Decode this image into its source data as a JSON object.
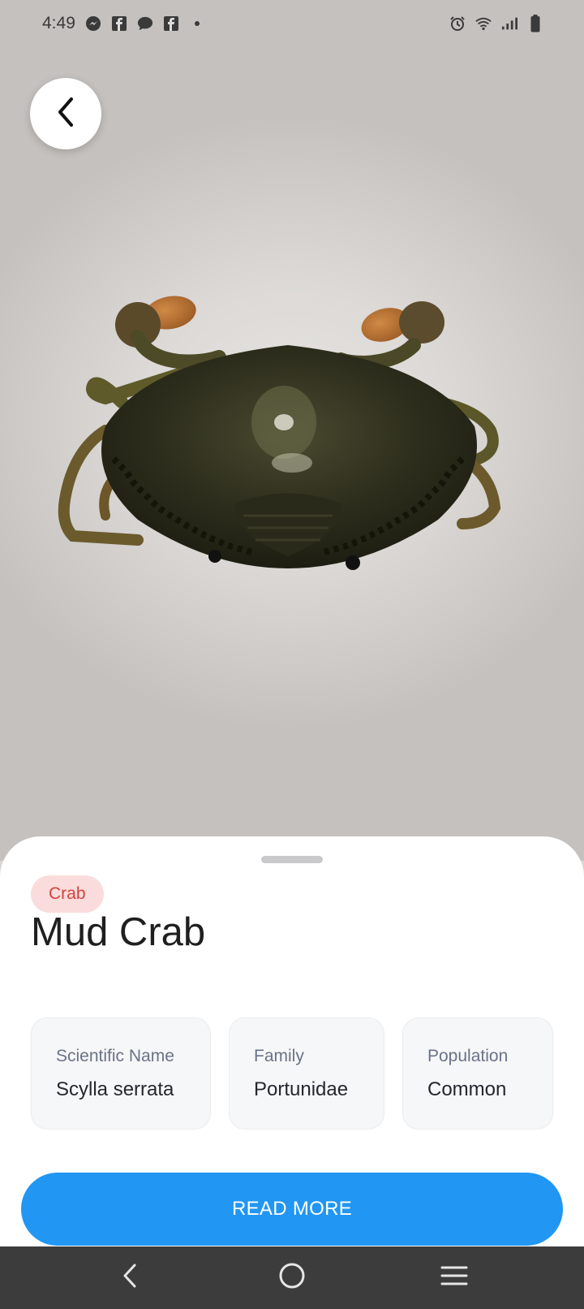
{
  "status_bar": {
    "time": "4:49",
    "left_icons": [
      "messenger-icon",
      "facebook-icon",
      "chat-icon",
      "facebook-icon",
      "dot-icon"
    ],
    "right_icons": [
      "alarm-icon",
      "wifi-icon",
      "signal-icon",
      "battery-icon"
    ]
  },
  "species": {
    "category_tag": "Crab",
    "name": "Mud Crab",
    "info_cards": [
      {
        "label": "Scientific Name",
        "value": "Scylla serrata"
      },
      {
        "label": "Family",
        "value": "Portunidae"
      },
      {
        "label": "Population",
        "value": "Common"
      }
    ]
  },
  "actions": {
    "read_more_label": "READ MORE"
  },
  "colors": {
    "accent": "#2196f3",
    "tag_bg": "#fbdcdc",
    "tag_text": "#d2443f",
    "nav_bar": "#3c3c3c"
  }
}
